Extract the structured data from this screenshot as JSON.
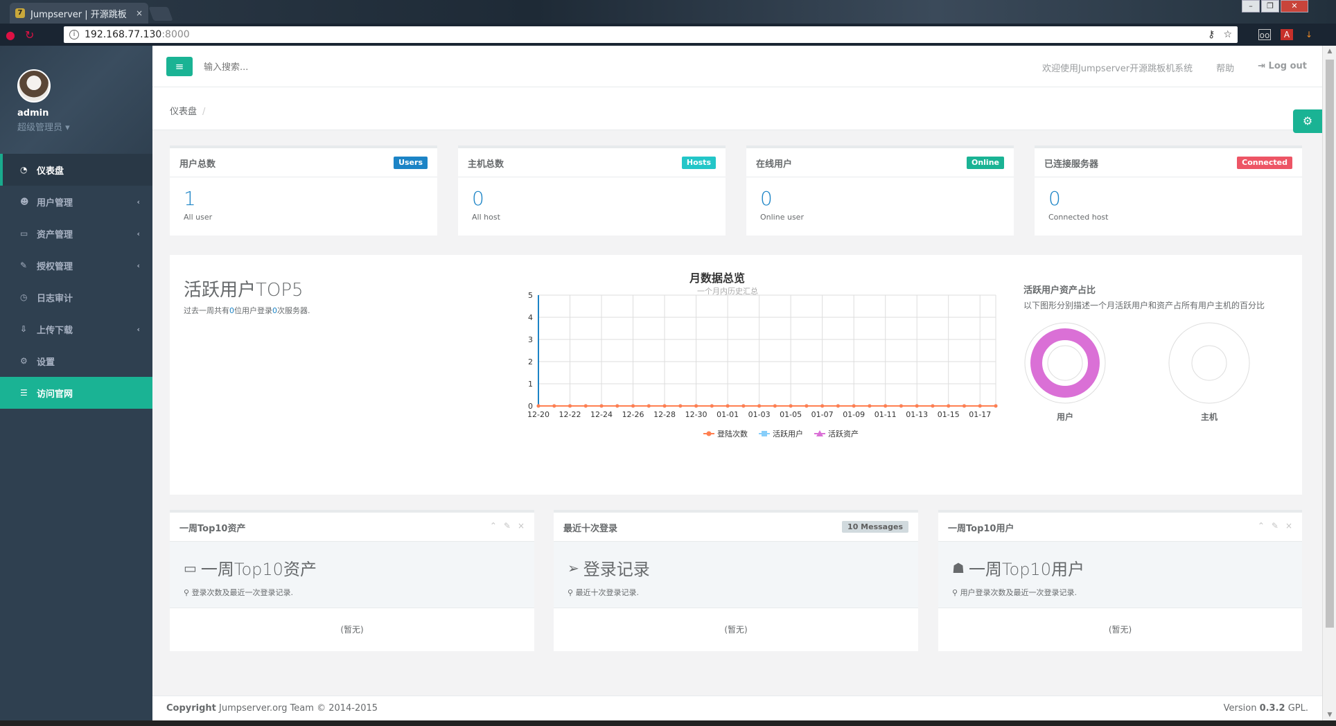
{
  "browser": {
    "tab_title": "Jumpserver | 开源跳板",
    "favicon": "7",
    "tab_close": "×",
    "url_host": "192.168.77.130",
    "url_port": ":8000",
    "ext_icons": [
      "oo",
      "A",
      "↓"
    ]
  },
  "sidebar": {
    "user_name": "admin",
    "user_role": "超级管理员 ▾",
    "items": [
      {
        "label": "仪表盘",
        "icon": "dashboard-icon",
        "glyph": "◔",
        "active": true
      },
      {
        "label": "用户管理",
        "icon": "users-icon",
        "glyph": "☻",
        "arrow": "‹"
      },
      {
        "label": "资产管理",
        "icon": "inbox-icon",
        "glyph": "▭",
        "arrow": "‹"
      },
      {
        "label": "授权管理",
        "icon": "edit-icon",
        "glyph": "✎",
        "arrow": "‹"
      },
      {
        "label": "日志审计",
        "icon": "history-icon",
        "glyph": "◷"
      },
      {
        "label": "上传下载",
        "icon": "download-icon",
        "glyph": "⇩",
        "arrow": "‹"
      },
      {
        "label": "设置",
        "icon": "gears-icon",
        "glyph": "⚙"
      },
      {
        "label": "访问官网",
        "icon": "database-icon",
        "glyph": "☰"
      }
    ]
  },
  "topbar": {
    "menu_glyph": "≡",
    "search_placeholder": "输入搜索...",
    "welcome": "欢迎使用Jumpserver开源跳板机系统",
    "help": "帮助",
    "logout_glyph": "⇥",
    "logout": "Log out"
  },
  "breadcrumb": {
    "current": "仪表盘",
    "sep": "/"
  },
  "stats": [
    {
      "title": "用户总数",
      "badge": "Users",
      "color": "#1c84c6",
      "value": "1",
      "sub": "All user"
    },
    {
      "title": "主机总数",
      "badge": "Hosts",
      "color": "#23c6c8",
      "value": "0",
      "sub": "All host"
    },
    {
      "title": "在线用户",
      "badge": "Online",
      "color": "#1ab394",
      "value": "0",
      "sub": "Online user"
    },
    {
      "title": "已连接服务器",
      "badge": "Connected",
      "color": "#ed5565",
      "value": "0",
      "sub": "Connected host"
    }
  ],
  "top5": {
    "title": "活跃用户TOP5",
    "desc_pre": "过去一周共有",
    "users": "0",
    "desc_mid": "位用户登录",
    "times": "0",
    "desc_post": "次服务器."
  },
  "chart_data": {
    "type": "line",
    "title": "月数据总览",
    "subtitle": "一个月内历史汇总",
    "xlabel": "",
    "ylabel": "",
    "ylim": [
      0,
      5
    ],
    "yticks": [
      0,
      1,
      2,
      3,
      4,
      5
    ],
    "x": [
      "12-20",
      "12-21",
      "12-22",
      "12-23",
      "12-24",
      "12-25",
      "12-26",
      "12-27",
      "12-28",
      "12-29",
      "12-30",
      "12-31",
      "01-01",
      "01-02",
      "01-03",
      "01-04",
      "01-05",
      "01-06",
      "01-07",
      "01-08",
      "01-09",
      "01-10",
      "01-11",
      "01-12",
      "01-13",
      "01-14",
      "01-15",
      "01-16",
      "01-17",
      "01-18"
    ],
    "x_tick_labels": [
      "12-20",
      "12-22",
      "12-24",
      "12-26",
      "12-28",
      "12-30",
      "01-01",
      "01-03",
      "01-05",
      "01-07",
      "01-09",
      "01-11",
      "01-13",
      "01-15",
      "01-17"
    ],
    "series": [
      {
        "name": "登陆次数",
        "color": "#ff7f50",
        "marker": "circle",
        "values": [
          0,
          0,
          0,
          0,
          0,
          0,
          0,
          0,
          0,
          0,
          0,
          0,
          0,
          0,
          0,
          0,
          0,
          0,
          0,
          0,
          0,
          0,
          0,
          0,
          0,
          0,
          0,
          0,
          0,
          0
        ]
      },
      {
        "name": "活跃用户",
        "color": "#87cefa",
        "marker": "square",
        "values": [
          0,
          0,
          0,
          0,
          0,
          0,
          0,
          0,
          0,
          0,
          0,
          0,
          0,
          0,
          0,
          0,
          0,
          0,
          0,
          0,
          0,
          0,
          0,
          0,
          0,
          0,
          0,
          0,
          0,
          0
        ]
      },
      {
        "name": "活跃资产",
        "color": "#da70d6",
        "marker": "triangle",
        "values": [
          0,
          0,
          0,
          0,
          0,
          0,
          0,
          0,
          0,
          0,
          0,
          0,
          0,
          0,
          0,
          0,
          0,
          0,
          0,
          0,
          0,
          0,
          0,
          0,
          0,
          0,
          0,
          0,
          0,
          0
        ]
      }
    ],
    "grid": true,
    "legend": "bottom-center"
  },
  "share": {
    "title": "活跃用户资产占比",
    "desc": "以下图形分别描述一个月活跃用户和资产占所有用户主机的百分比",
    "rings": [
      {
        "label": "用户",
        "percent": 100,
        "color": "#da70d6"
      },
      {
        "label": "主机",
        "percent": 0,
        "color": "#da70d6"
      }
    ]
  },
  "panels": [
    {
      "title": "一周Top10资产",
      "icon": "inbox-icon",
      "glyph": "▭",
      "big": "一周Top10资产",
      "desc": "登录次数及最近一次登录记录.",
      "empty": "(暂无)",
      "tools": [
        "⌃",
        "✎",
        "×"
      ]
    },
    {
      "title": "最近十次登录",
      "badge": "10 Messages",
      "icon": "paper-plane-icon",
      "glyph": "➢",
      "big": "登录记录",
      "desc": "最近十次登录记录.",
      "empty": "(暂无)"
    },
    {
      "title": "一周Top10用户",
      "icon": "user-icon",
      "glyph": "☗",
      "big": "一周Top10用户",
      "desc": "用户登录次数及最近一次登录记录.",
      "empty": "(暂无)",
      "tools": [
        "⌃",
        "✎",
        "×"
      ]
    }
  ],
  "footer": {
    "copyright_bold": "Copyright",
    "copyright_rest": " Jumpserver.org Team © 2014-2015",
    "version_pre": "Version ",
    "version_num": "0.3.2",
    "version_post": " GPL."
  }
}
